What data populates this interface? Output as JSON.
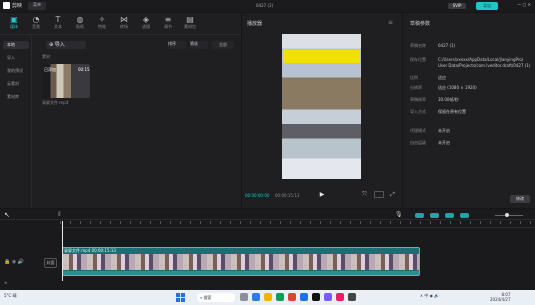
{
  "titlebar": {
    "app_name": "剪映",
    "menu_label": "菜单",
    "project_title": "0427 (1)",
    "pro_badge": "SVIP",
    "export_label": "导出",
    "window_controls": "— ▢ ✕"
  },
  "toolbar_tabs": [
    {
      "label": "媒体",
      "icon": "media-icon",
      "glyph": "▣"
    },
    {
      "label": "音频",
      "icon": "audio-icon",
      "glyph": "◔"
    },
    {
      "label": "文本",
      "icon": "text-icon",
      "glyph": "T"
    },
    {
      "label": "贴纸",
      "icon": "sticker-icon",
      "glyph": "◍"
    },
    {
      "label": "特效",
      "icon": "effects-icon",
      "glyph": "✧"
    },
    {
      "label": "转场",
      "icon": "transition-icon",
      "glyph": "⋈"
    },
    {
      "label": "滤镜",
      "icon": "filter-icon",
      "glyph": "◈"
    },
    {
      "label": "调节",
      "icon": "adjust-icon",
      "glyph": "≡"
    },
    {
      "label": "素材包",
      "icon": "package-icon",
      "glyph": "▤"
    }
  ],
  "side_nav": [
    {
      "label": "本地",
      "active": true
    },
    {
      "label": "导入",
      "active": false
    },
    {
      "label": "我的预设",
      "active": false
    },
    {
      "label": "云素材",
      "active": false
    },
    {
      "label": "素材库",
      "active": false
    }
  ],
  "media": {
    "import_label": "导入",
    "sort_label": "排序",
    "filter_label": "筛选",
    "all_label": "全部",
    "section_label": "素材",
    "clip_added_tag": "已添加",
    "clip_duration": "00:15",
    "clip_name": "录屏文件.mp4"
  },
  "player": {
    "title": "播放器",
    "menu_glyph": "≡",
    "time_current": "00:00:00:00",
    "time_total": "00:00:15:13",
    "play_glyph": "▶",
    "fit_glyph": "⤧",
    "fullscreen_glyph": "⤢"
  },
  "details": {
    "title": "草稿参数",
    "rows": [
      {
        "label": "草稿名称",
        "value": "0427 (1)"
      },
      {
        "label": "保存位置",
        "value": "C:/Users/xxxxx/AppData/Local/JianyingPro/"
      },
      {
        "label": "",
        "value": "User Data/Projects/com.lveditor.draft/0427 (1)"
      },
      {
        "label": "比例",
        "value": "适应"
      },
      {
        "label": "分辨率",
        "value": "适应 (1080 × 1920)"
      },
      {
        "label": "草稿帧率",
        "value": "30.00帧/秒"
      },
      {
        "label": "导入方式",
        "value": "保留在原有位置"
      },
      {
        "label": "代理模式",
        "value": "未开启"
      },
      {
        "label": "自由层级",
        "value": "未开启"
      }
    ],
    "modify_label": "修改"
  },
  "timeline": {
    "select_glyph": "↖",
    "split_glyph": "⫴",
    "mic_glyph": "🎙",
    "cover_label": "封面",
    "lock_glyph": "🔒 ◉ 🔊",
    "clip_label": "录屏文件.mp4  00:00:15:13",
    "add_track_glyph": "◂"
  },
  "taskbar": {
    "weather": "5°C 晴",
    "search_label": "搜索",
    "tray": "∧ 中 ◉ 🔊",
    "time": "8:07",
    "date": "2024/4/27"
  },
  "colors": {
    "accent": "#22c7cc",
    "banner": "#f3e000",
    "clip": "#1c6e72"
  }
}
